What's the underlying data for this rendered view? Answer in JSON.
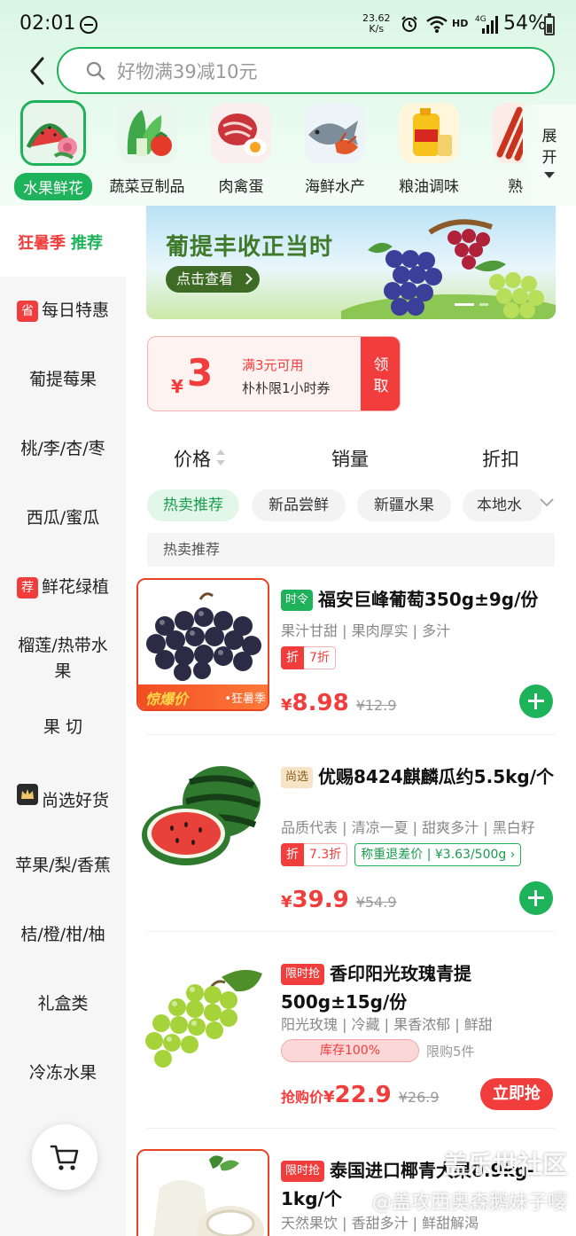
{
  "status_bar": {
    "time": "02:01",
    "net_speed_value": "23.62",
    "net_speed_unit": "K/s",
    "hd": "HD",
    "network": "4G",
    "battery": "54%"
  },
  "search": {
    "placeholder": "好物满39减10元"
  },
  "categories": [
    {
      "label": "水果鲜花",
      "icon": "fruit-flower",
      "active": true
    },
    {
      "label": "蔬菜豆制品",
      "icon": "vegetable"
    },
    {
      "label": "肉禽蛋",
      "icon": "meat-egg"
    },
    {
      "label": "海鲜水产",
      "icon": "seafood"
    },
    {
      "label": "粮油调味",
      "icon": "grain-oil"
    },
    {
      "label": "熟食",
      "icon": "cooked-food"
    }
  ],
  "expand": {
    "label": "展开"
  },
  "sidebar": {
    "top_a": "狂暑季",
    "top_b": "推荐",
    "items": [
      {
        "badge": "省",
        "label": "每日特惠"
      },
      {
        "label": "葡提莓果"
      },
      {
        "label": "桃/李/杏/枣"
      },
      {
        "label": "西瓜/蜜瓜"
      },
      {
        "badge": "荐",
        "label": "鲜花绿植"
      },
      {
        "label": "榴莲/热带水果"
      },
      {
        "label": "果 切"
      },
      {
        "badge": "尚",
        "label": "尚选好货"
      },
      {
        "label": "苹果/梨/香蕉"
      },
      {
        "label": "桔/橙/柑/柚"
      },
      {
        "label": "礼盒类"
      },
      {
        "label": "冷冻水果"
      }
    ]
  },
  "banner": {
    "title": "葡提丰收正当时",
    "button": "点击查看"
  },
  "coupon": {
    "yen": "¥",
    "amount": "3",
    "condition": "满3元可用",
    "description": "朴朴限1小时券",
    "claim_line1": "领",
    "claim_line2": "取"
  },
  "sort": {
    "price": "价格",
    "sales": "销量",
    "discount": "折扣"
  },
  "chips": [
    {
      "label": "热卖推荐",
      "active": true
    },
    {
      "label": "新品尝鲜"
    },
    {
      "label": "新疆水果"
    },
    {
      "label": "本地水"
    }
  ],
  "section_label": "热卖推荐",
  "products": [
    {
      "tag": "时令",
      "title": "福安巨峰葡萄350g±9g/份",
      "subtitle": "果汁甘甜 | 果肉厚实 | 多汁",
      "discount_icon": "折",
      "discount": "7折",
      "price_yen": "¥",
      "price": "8.98",
      "original_price": "¥12.9",
      "frame_badge_a": "惊爆价",
      "frame_badge_b": "•狂暑季"
    },
    {
      "tag": "尚选",
      "title": "优赐8424麒麟瓜约5.5kg/个",
      "subtitle": "品质代表 | 清凉一夏 | 甜爽多汁 | 黑白籽",
      "discount_icon": "折",
      "discount": "7.3折",
      "extra": "称重退差价 | ¥3.63/500g ›",
      "price_yen": "¥",
      "price": "39.9",
      "original_price": "¥54.9"
    },
    {
      "tag": "限时抢",
      "title": "香印阳光玫瑰青提500g±15g/份",
      "subtitle": "阳光玫瑰 | 冷藏 | 果香浓郁 | 鲜甜",
      "stock_label": "库存100%",
      "stock_level": 1.0,
      "limit": "限购5件",
      "price_prefix": "抢购价",
      "price_yen": "¥",
      "price": "22.9",
      "original_price": "¥26.9",
      "buy_label": "立即抢"
    },
    {
      "tag": "限时抢",
      "title": "泰国进口椰青大果0.9kg-1kg/个",
      "subtitle": "天然果饮 | 香甜多汁 | 鲜甜解渴"
    }
  ],
  "watermark": {
    "line1": "盖乐世社区",
    "line2": "@盖攻西奥森鹅妹子嘤"
  },
  "colors": {
    "brand_green": "#1eb25a",
    "accent_red": "#f23d3d"
  }
}
